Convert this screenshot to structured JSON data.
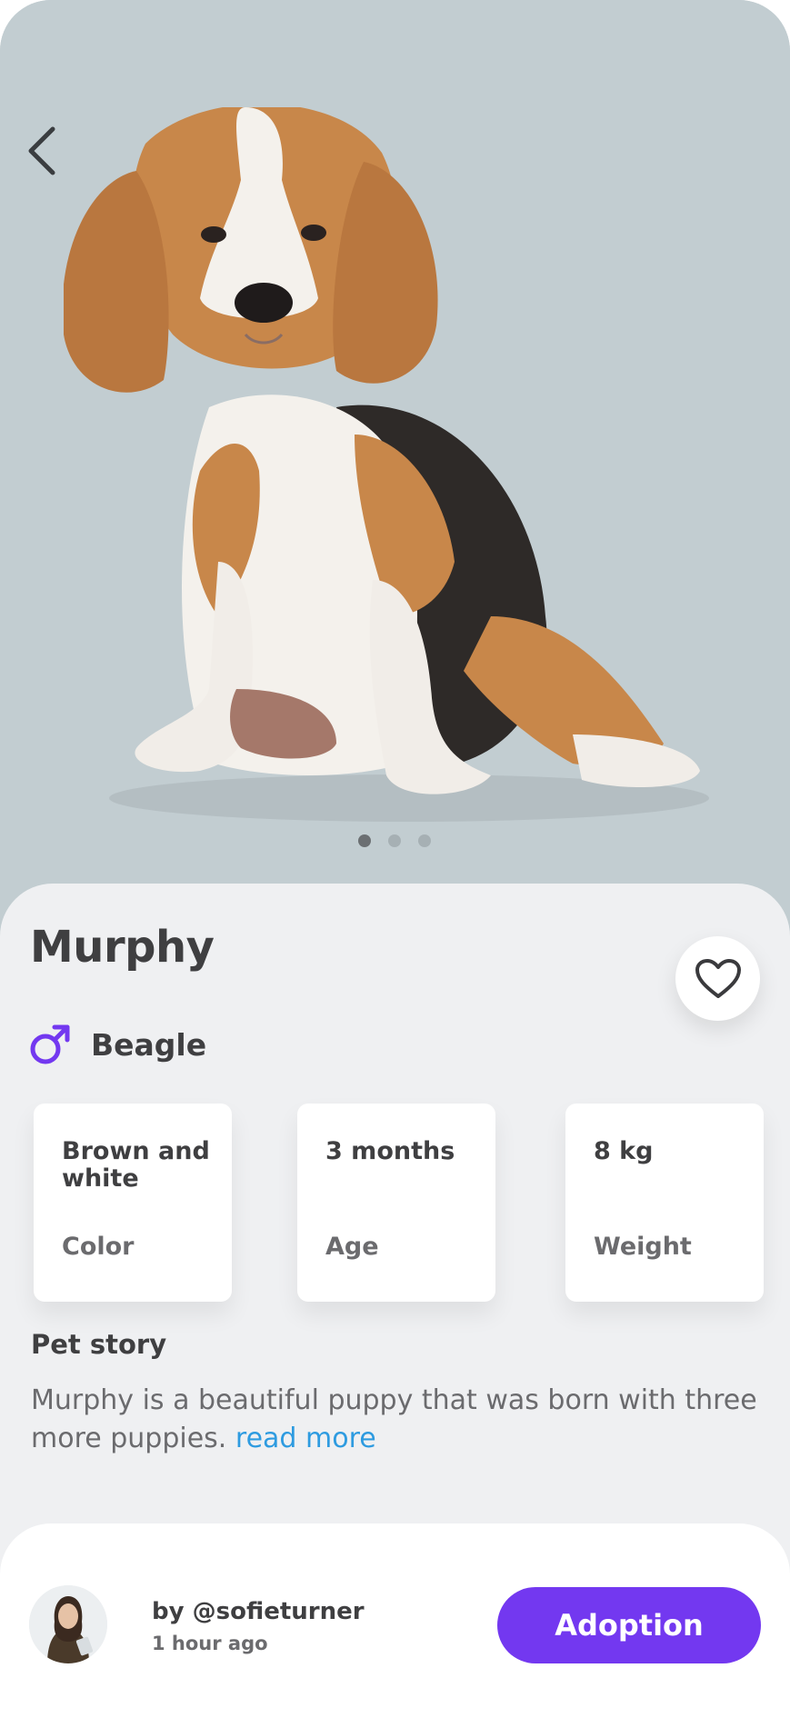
{
  "hero": {
    "image_alt": "beagle puppy photo",
    "carousel": {
      "count": 3,
      "active_index": 0
    }
  },
  "pet": {
    "name": "Murphy",
    "gender_icon": "male-symbol-icon",
    "breed": "Beagle"
  },
  "stats": [
    {
      "value": "Brown and white",
      "label": "Color"
    },
    {
      "value": "3 months",
      "label": "Age"
    },
    {
      "value": "8 kg",
      "label": "Weight"
    }
  ],
  "story": {
    "title": "Pet story",
    "text": "Murphy is a beautiful puppy that was born with three more puppies. ",
    "read_more": "read more"
  },
  "owner": {
    "handle": "by @sofieturner",
    "posted": "1 hour ago"
  },
  "actions": {
    "adopt_label": "Adoption"
  },
  "colors": {
    "accent": "#7338f0",
    "link": "#2e9be0",
    "hero_bg": "#c2cdd1",
    "sheet_bg": "#eff0f2"
  }
}
